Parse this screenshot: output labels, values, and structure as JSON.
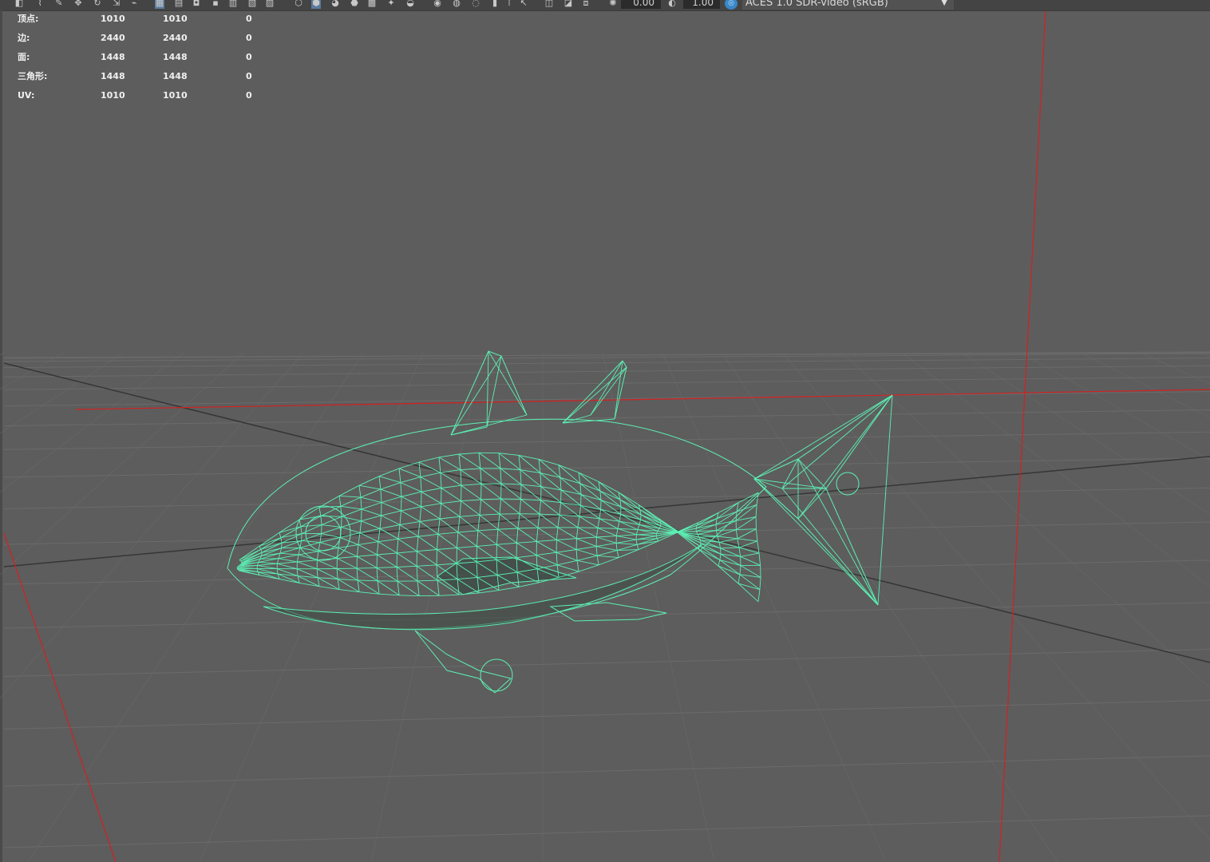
{
  "toolbar": {
    "exposure_value": "0.00",
    "gamma_value": "1.00",
    "color_space": "ACES 1.0 SDR-video (sRGB)",
    "icons": [
      "select-icon",
      "lasso-icon",
      "paint-icon",
      "move-icon",
      "rotate-icon",
      "scale-icon",
      "grid-icon",
      "film-gate-icon",
      "resolution-gate-icon",
      "safe-action-icon",
      "wireframe-icon",
      "smooth-shade-icon",
      "bounding-box-icon",
      "textured-icon",
      "lights-icon",
      "shadows-icon",
      "ambient-occlusion-icon",
      "antialias-icon",
      "isolate-icon",
      "xray-icon",
      "xray-joints-icon",
      "backface-icon",
      "exposure-icon",
      "gamma-icon",
      "color-management-icon"
    ]
  },
  "hud": {
    "rows": [
      {
        "label": "顶点:",
        "a": "1010",
        "b": "1010",
        "c": "0"
      },
      {
        "label": "边:",
        "a": "2440",
        "b": "2440",
        "c": "0"
      },
      {
        "label": "面:",
        "a": "1448",
        "b": "1448",
        "c": "0"
      },
      {
        "label": "三角形:",
        "a": "1448",
        "b": "1448",
        "c": "0"
      },
      {
        "label": "UV:",
        "a": "1010",
        "b": "1010",
        "c": "0"
      }
    ]
  },
  "colors": {
    "viewport_bg": "#5d5d5d",
    "wireframe": "#5cf0b4",
    "camera_frustum": "#d42020",
    "grid": "#6b6b6b",
    "grid_axis": "#363636"
  }
}
